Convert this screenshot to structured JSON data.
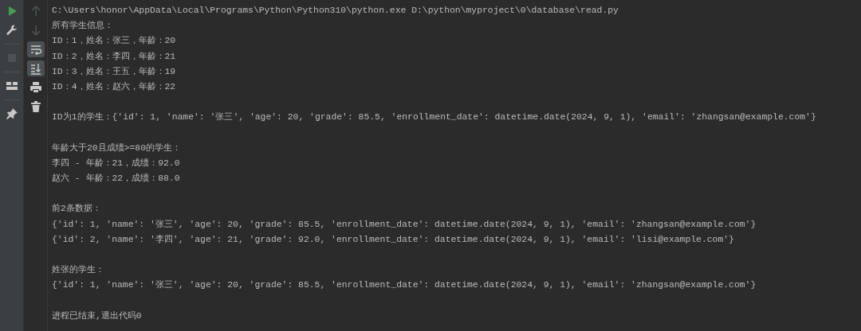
{
  "left_toolbar": [
    {
      "kind": "run",
      "disabled": false,
      "selected": false
    },
    {
      "kind": "wrench",
      "disabled": false,
      "selected": false
    },
    {
      "kind": "stop",
      "disabled": true,
      "selected": false
    },
    {
      "kind": "layout",
      "disabled": false,
      "selected": false
    },
    {
      "kind": "pin",
      "disabled": false,
      "selected": false
    }
  ],
  "right_toolbar": [
    {
      "kind": "up",
      "disabled": true,
      "selected": false
    },
    {
      "kind": "down",
      "disabled": true,
      "selected": false
    },
    {
      "kind": "wrap",
      "disabled": false,
      "selected": true
    },
    {
      "kind": "scroll-end",
      "disabled": false,
      "selected": true
    },
    {
      "kind": "print",
      "disabled": false,
      "selected": false
    },
    {
      "kind": "trash",
      "disabled": false,
      "selected": false
    }
  ],
  "console": {
    "blocks": [
      [
        "C:\\Users\\honor\\AppData\\Local\\Programs\\Python\\Python310\\python.exe D:\\python\\myproject\\0\\database\\read.py",
        "所有学生信息：",
        "ID：1，姓名：张三，年龄：20",
        "ID：2，姓名：李四，年龄：21",
        "ID：3，姓名：王五，年龄：19",
        "ID：4，姓名：赵六，年龄：22"
      ],
      [
        "ID为1的学生：{'id': 1, 'name': '张三', 'age': 20, 'grade': 85.5, 'enrollment_date': datetime.date(2024, 9, 1), 'email': 'zhangsan@example.com'}"
      ],
      [
        "年龄大于20且成绩>=80的学生：",
        "李四 - 年龄：21，成绩：92.0",
        "赵六 - 年龄：22，成绩：88.0"
      ],
      [
        "前2条数据：",
        "{'id': 1, 'name': '张三', 'age': 20, 'grade': 85.5, 'enrollment_date': datetime.date(2024, 9, 1), 'email': 'zhangsan@example.com'}",
        "{'id': 2, 'name': '李四', 'age': 21, 'grade': 92.0, 'enrollment_date': datetime.date(2024, 9, 1), 'email': 'lisi@example.com'}"
      ],
      [
        "姓张的学生：",
        "{'id': 1, 'name': '张三', 'age': 20, 'grade': 85.5, 'enrollment_date': datetime.date(2024, 9, 1), 'email': 'zhangsan@example.com'}"
      ],
      [
        "进程已结束,退出代码0"
      ]
    ]
  }
}
